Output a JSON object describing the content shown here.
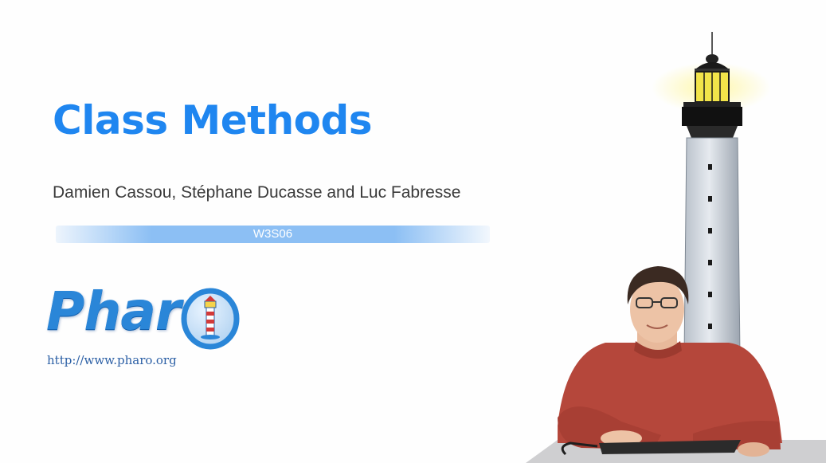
{
  "slide": {
    "title": "Class Methods",
    "authors": "Damien Cassou, Stéphane Ducasse and Luc Fabresse",
    "code": "W3S06",
    "logo": {
      "text": "Phar",
      "url": "http://www.pharo.org"
    }
  },
  "colors": {
    "title": "#1f86f0",
    "code_bar": "#8cbff4",
    "logo": "#2a86d8",
    "sweater": "#b5473b"
  },
  "icons": [
    "pharo-lighthouse-logo-icon",
    "lighthouse-illustration",
    "presenter-video"
  ]
}
